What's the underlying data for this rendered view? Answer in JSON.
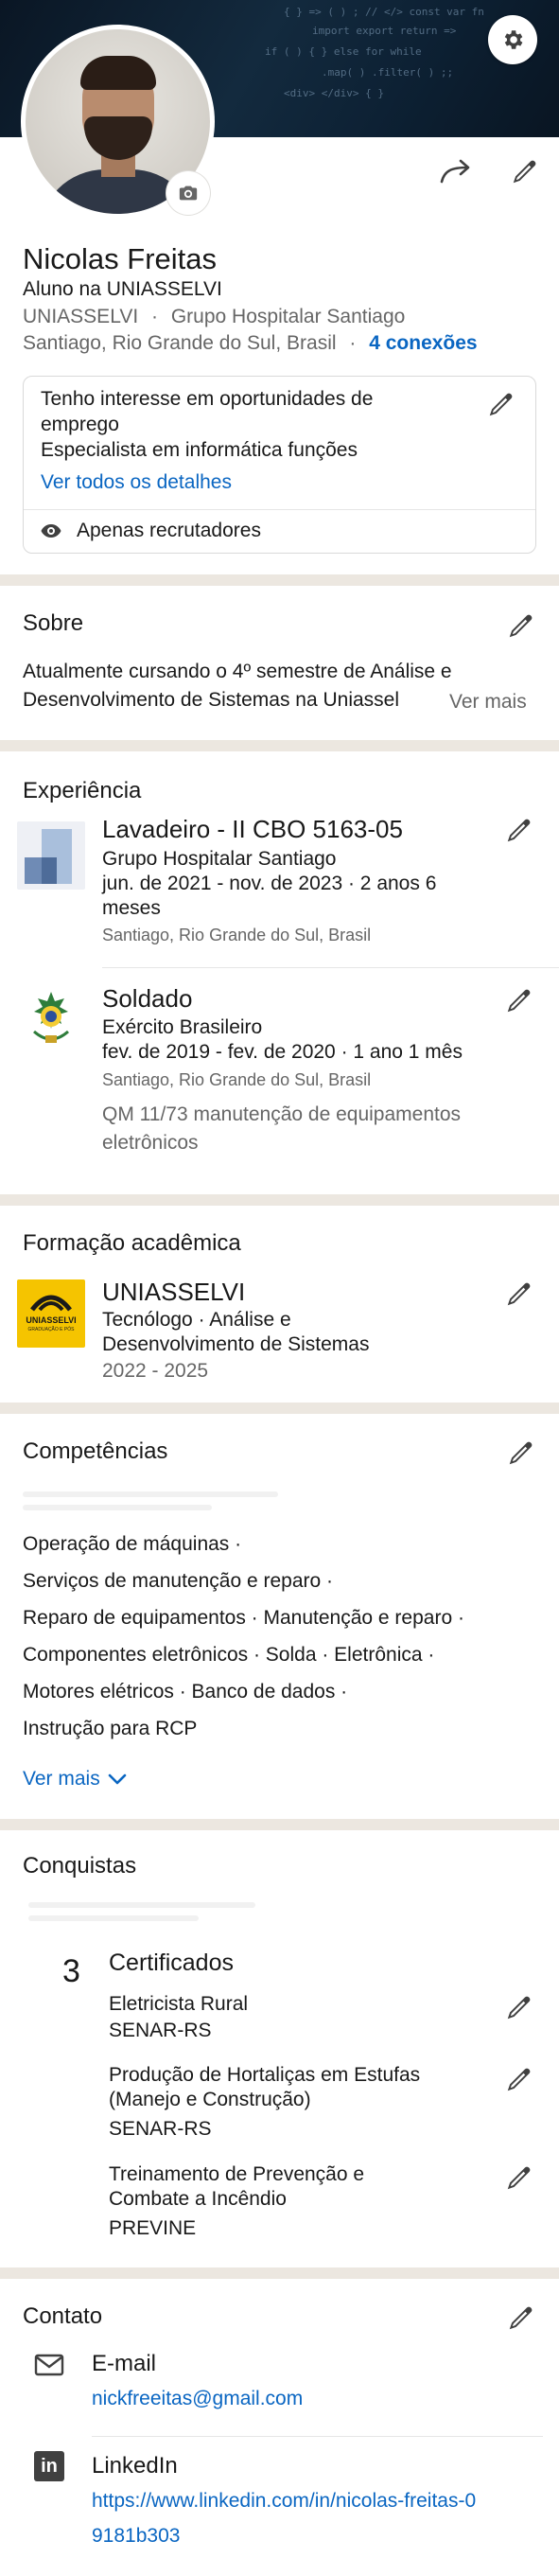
{
  "profile": {
    "name": "Nicolas Freitas",
    "headline": "Aluno na UNIASSELVI",
    "company": "UNIASSELVI",
    "separator": "·",
    "company2": "Grupo Hospitalar Santiago",
    "location": "Santiago, Rio Grande do Sul, Brasil",
    "connections": "4 conexões"
  },
  "open_to_work": {
    "title": "Tenho interesse em oportunidades de emprego",
    "title_line1": "Tenho interesse em oportunidades de",
    "title_line2": "emprego",
    "role": "Especialista em informática funções",
    "details_link": "Ver todos os detalhes",
    "visibility": "Apenas recrutadores"
  },
  "about": {
    "title": "Sobre",
    "line1": "Atualmente cursando o 4º semestre de Análise e",
    "line2": "Desenvolvimento de Sistemas na Uniassel",
    "see_more": "Ver mais"
  },
  "experience": {
    "title": "Experiência",
    "items": [
      {
        "role": "Lavadeiro - II CBO 5163-05",
        "company": "Grupo Hospitalar Santiago",
        "dates_line1": "jun. de 2021 - nov. de 2023  ·  2 anos 6",
        "dates_line2": "meses",
        "location": "Santiago, Rio Grande do Sul, Brasil"
      },
      {
        "role": "Soldado",
        "company": "Exército Brasileiro",
        "dates_line1": "fev. de 2019 - fev. de 2020  ·  1 ano 1 mês",
        "location": "Santiago, Rio Grande do Sul, Brasil",
        "desc_line1": "QM 11/73 manutenção de equipamentos",
        "desc_line2": "eletrônicos"
      }
    ]
  },
  "education": {
    "title": "Formação acadêmica",
    "school": "UNIASSELVI",
    "degree_line1": "Tecnólogo  ·  Análise e",
    "degree_line2": "Desenvolvimento de Sistemas",
    "years": "2022 - 2025",
    "logo_text": "UNIASSELVI",
    "logo_sub": "GRADUAÇÃO E PÓS"
  },
  "skills": {
    "title": "Competências",
    "lines": [
      "Operação de máquinas  ·",
      "Serviços de manutenção e reparo  ·",
      "Reparo de equipamentos  ·  Manutenção e reparo  ·",
      "Componentes eletrônicos  ·  Solda  ·  Eletrônica  ·",
      "Motores elétricos  ·  Banco de dados  ·",
      "Instrução para RCP"
    ],
    "see_more": "Ver mais"
  },
  "accomplishments": {
    "title": "Conquistas",
    "count": "3",
    "category": "Certificados",
    "items": [
      {
        "line1": "Eletricista Rural",
        "issuer": "SENAR-RS"
      },
      {
        "line1": "Produção de Hortaliças em Estufas",
        "line2": "(Manejo e Construção)",
        "issuer": "SENAR-RS"
      },
      {
        "line1": "Treinamento de Prevenção e",
        "line2": "Combate a Incêndio",
        "issuer": "PREVINE"
      }
    ]
  },
  "contact": {
    "title": "Contato",
    "email_label": "E-mail",
    "email": "nickfreeitas@gmail.com",
    "linkedin_label": "LinkedIn",
    "linkedin_line1": "https://www.linkedin.com/in/nicolas-freitas-0",
    "linkedin_line2": "9181b303"
  },
  "icons": {
    "settings": "gear-icon",
    "camera": "camera-icon",
    "share": "share-arrow-icon",
    "edit": "pencil-icon",
    "eye": "eye-icon",
    "mail": "mail-icon",
    "linkedin": "linkedin-icon",
    "chevron": "chevron-down-icon"
  },
  "colors": {
    "link": "#0a66c2",
    "section_separator": "#ece7e0",
    "text": "#191919",
    "muted": "#666666",
    "banner": "#0d2134",
    "uniasselvi_logo": "#f5c400"
  }
}
